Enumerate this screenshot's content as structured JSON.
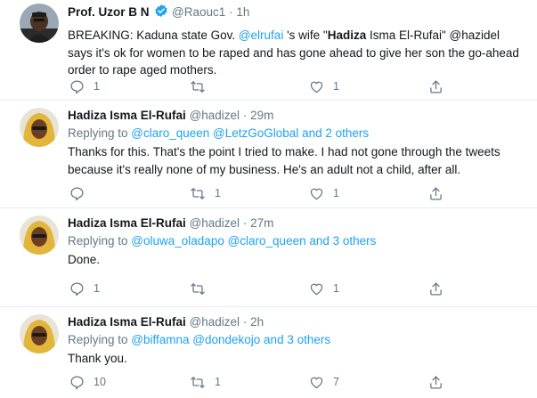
{
  "tweets": [
    {
      "name": "Prof. Uzor B N",
      "handle": "@Raouc1",
      "time": "1h",
      "verified": true,
      "reply_prefix": "",
      "reply_mentions": "",
      "reply_suffix": "",
      "text_parts": [
        {
          "t": "BREAKING: Kaduna state Gov. ",
          "style": "plain"
        },
        {
          "t": "@elrufai",
          "style": "link"
        },
        {
          "t": " 's wife \"",
          "style": "plain"
        },
        {
          "t": "Hadiza",
          "style": "bold"
        },
        {
          "t": " Isma El-Rufai\" @hazidel says it's ok for women to be raped and has gone ahead to give her son the go-ahead order to rape aged mothers.",
          "style": "plain"
        }
      ],
      "counts": {
        "reply": "1",
        "retweet": "",
        "like": "1"
      }
    },
    {
      "name": "Hadiza Isma El-Rufai",
      "handle": "@hadizel",
      "time": "29m",
      "verified": false,
      "reply_prefix": "Replying to ",
      "reply_mentions": "@claro_queen @LetzGoGlobal and 2 others",
      "reply_suffix": "",
      "text_parts": [
        {
          "t": "Thanks for this. That's the point I tried to make. I had not gone through the tweets because it's really none of my business. He's an adult not a child, after all.",
          "style": "plain"
        }
      ],
      "counts": {
        "reply": "",
        "retweet": "1",
        "like": "1"
      }
    },
    {
      "name": "Hadiza Isma El-Rufai",
      "handle": "@hadizel",
      "time": "27m",
      "verified": false,
      "reply_prefix": "Replying to ",
      "reply_mentions": "@oluwa_oladapo @claro_queen and 3 others",
      "reply_suffix": "",
      "text_parts": [
        {
          "t": "Done.",
          "style": "plain"
        }
      ],
      "counts": {
        "reply": "1",
        "retweet": "",
        "like": "1"
      }
    },
    {
      "name": "Hadiza Isma El-Rufai",
      "handle": "@hadizel",
      "time": "2h",
      "verified": false,
      "reply_prefix": "Replying to ",
      "reply_mentions": "@biffamna @dondekojo and 3 others",
      "reply_suffix": "",
      "text_parts": [
        {
          "t": "Thank you.",
          "style": "plain"
        }
      ],
      "counts": {
        "reply": "10",
        "retweet": "1",
        "like": "7"
      }
    }
  ],
  "separator_dot": "·",
  "icons": {
    "reply": "reply-icon",
    "retweet": "retweet-icon",
    "like": "heart-icon",
    "share": "share-icon",
    "verified": "verified-badge-icon"
  },
  "colors": {
    "link": "#1da1f2",
    "secondary": "#657786",
    "verified": "#1da1f2",
    "divider": "#e6ecf0"
  }
}
